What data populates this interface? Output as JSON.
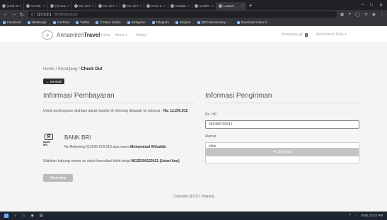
{
  "browser": {
    "tabs": [
      {
        "label": "(152) W"
      },
      {
        "label": "GLADI"
      },
      {
        "label": "(2) Gee"
      },
      {
        "label": "NU Onl"
      },
      {
        "label": "NU Onl"
      },
      {
        "label": "NU Onl"
      },
      {
        "label": "Drive S"
      },
      {
        "label": "Databa"
      },
      {
        "label": "localho"
      },
      {
        "label": "Laravel"
      }
    ],
    "url_host": "127.0.0.1",
    "url_path": ":8000/checkout",
    "bookmarks": [
      "Facebook",
      "WhatsApp",
      "YouTube",
      "Twitter",
      "Creator Studio",
      "Instagram",
      "Telegram",
      "Shopee",
      "QRCode Monkey -...",
      "Download Video fr..."
    ]
  },
  "navbar": {
    "brand_prefix": "Annamirch",
    "brand_bold": "Travel",
    "links": [
      "Home",
      "Menu ▾",
      "History"
    ],
    "cart_label": "Keranjang",
    "cart_count": "0",
    "user_label": "Mohammad Rifky ▾"
  },
  "breadcrumb": {
    "home": "Home",
    "sep1": " / ",
    "cart": "Keranjang",
    "sep2": " / ",
    "current": "Check Out"
  },
  "back_label": "← Kembali",
  "payment": {
    "heading": "Informasi Pembayaran",
    "note": "Untuk pembayaran silahkan dapat transfer di rekening dibawah ini sebesar : ",
    "amount": "Rp. 12,250,915",
    "bank_logo_text": "BANK BRI",
    "bank_name": "BANK BRI",
    "account_prefix": "No Rekening ",
    "account_number": "012345-678-910",
    "account_mid": " atas nama ",
    "account_holder": "Muhammad Afifuddin",
    "contact_note": "Silahkan hubungi nomer ini untuk konsultasi lebih lanjut ",
    "contact_number": "081322901234​21 (Ustad Anu)",
    "whatsapp_label": "WhatsApp"
  },
  "shipping": {
    "heading": "Informasi Pengiriman",
    "phone_label": "No. HP",
    "phone_value": "965489765543",
    "address_label": "Alamat",
    "address_value": "sfsfs",
    "checkout_label": "➜ Checkout"
  },
  "footer": "Copyright @2021 Magang",
  "taskbar": {
    "tray": "ENG 10:22 PM"
  }
}
